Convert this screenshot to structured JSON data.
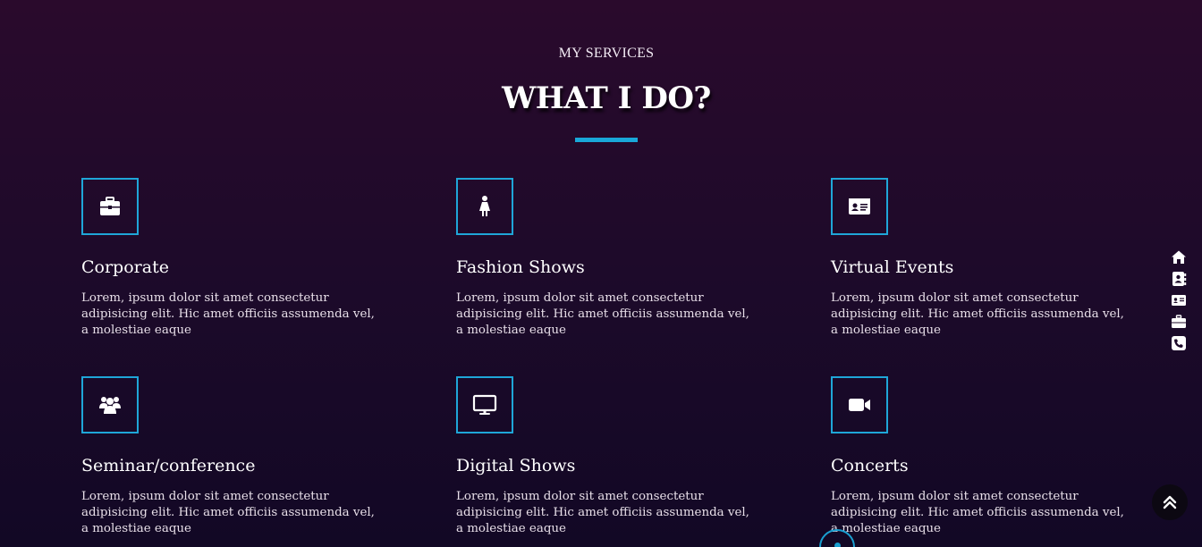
{
  "header": {
    "eyebrow": "MY SERVICES",
    "title": "WHAT I DO?"
  },
  "services": [
    {
      "title": "Corporate",
      "text": "Lorem, ipsum dolor sit amet consectetur adipisicing elit. Hic amet officiis assumenda vel, a molestiae eaque",
      "icon": "briefcase-icon"
    },
    {
      "title": "Fashion Shows",
      "text": "Lorem, ipsum dolor sit amet consectetur adipisicing elit. Hic amet officiis assumenda vel, a molestiae eaque",
      "icon": "female-figure-icon"
    },
    {
      "title": "Virtual Events",
      "text": "Lorem, ipsum dolor sit amet consectetur adipisicing elit. Hic amet officiis assumenda vel, a molestiae eaque",
      "icon": "id-card-icon"
    },
    {
      "title": "Seminar/conference",
      "text": "Lorem, ipsum dolor sit amet consectetur adipisicing elit. Hic amet officiis assumenda vel, a molestiae eaque",
      "icon": "users-icon"
    },
    {
      "title": "Digital Shows",
      "text": "Lorem, ipsum dolor sit amet consectetur adipisicing elit. Hic amet officiis assumenda vel, a molestiae eaque",
      "icon": "monitor-icon"
    },
    {
      "title": "Concerts",
      "text": "Lorem, ipsum dolor sit amet consectetur adipisicing elit. Hic amet officiis assumenda vel, a molestiae eaque",
      "icon": "video-camera-icon"
    }
  ],
  "side_nav": [
    "home-icon",
    "address-book-icon",
    "id-card-icon",
    "briefcase-icon",
    "phone-icon"
  ],
  "back_to_top": "double-chevron-up-icon",
  "colors": {
    "accent": "#1fa6d8",
    "background_top": "#2a0a2c",
    "background_bottom": "#120825",
    "text": "#ffffff"
  }
}
